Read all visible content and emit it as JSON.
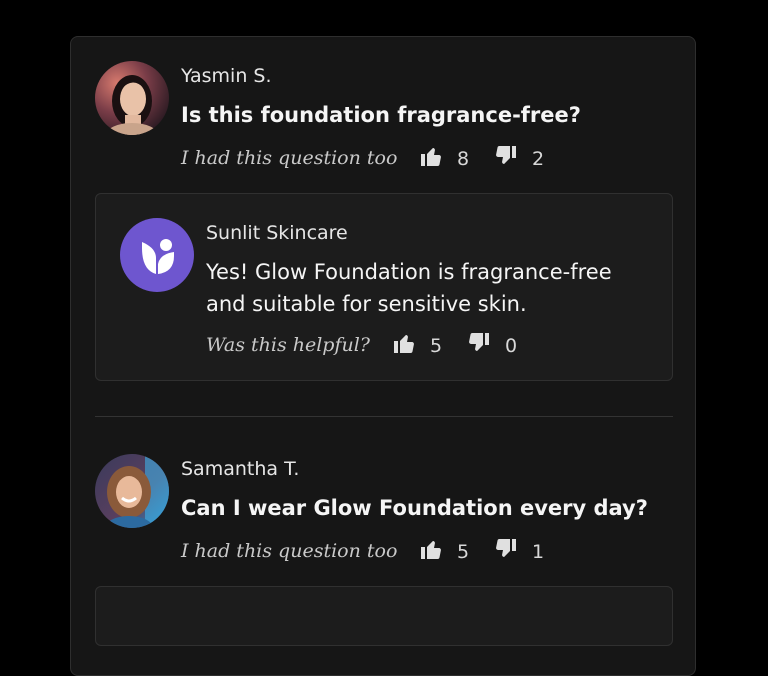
{
  "questions": [
    {
      "author": "Yasmin S.",
      "question": "Is this foundation fragrance-free?",
      "prompt": "I had this question too",
      "upvotes": "8",
      "downvotes": "2",
      "answer": {
        "author": "Sunlit Skincare",
        "text_line1": "Yes! Glow Foundation is fragrance-free",
        "text_line2": "and suitable for sensitive skin.",
        "prompt": "Was this helpful?",
        "upvotes": "5",
        "downvotes": "0"
      }
    },
    {
      "author": "Samantha T.",
      "question": "Can I wear Glow Foundation every day?",
      "prompt": "I had this question too",
      "upvotes": "5",
      "downvotes": "1"
    }
  ],
  "colors": {
    "brand_logo": "#6e56cf",
    "background": "#000000",
    "card": "#161616"
  }
}
